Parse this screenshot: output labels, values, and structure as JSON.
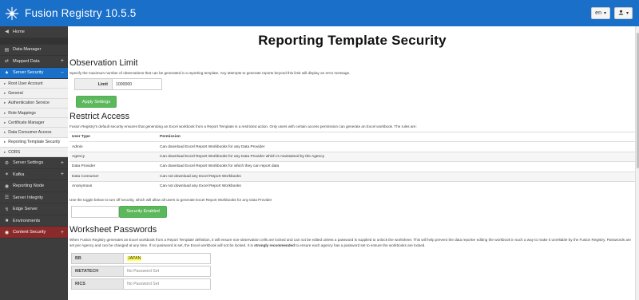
{
  "app": {
    "title": "Fusion Registry 10.5.5"
  },
  "topbar": {
    "language": "en",
    "user_caret": "▾",
    "lang_caret": "▾"
  },
  "sidebar": {
    "items": [
      {
        "label": "Home",
        "icon": "back-arrow-icon"
      },
      {
        "label": "Data Manager",
        "icon": "document-icon"
      },
      {
        "label": "Mapped Data",
        "icon": "shuffle-icon"
      },
      {
        "label": "Server Security",
        "icon": "shield-icon"
      }
    ],
    "sub_items": [
      "Root User Account",
      "General",
      "Authentication Service",
      "Role Mappings",
      "Certificate Manager",
      "Data Consumer Access",
      "Reporting Template Security",
      "CORS"
    ],
    "items_after": [
      {
        "label": "Server Settings",
        "icon": "gear-icon"
      },
      {
        "label": "Kafka",
        "icon": "kafka-icon"
      },
      {
        "label": "Reporting Node",
        "icon": "node-icon"
      },
      {
        "label": "Server Integrity",
        "icon": "integrity-icon"
      },
      {
        "label": "Edge Server",
        "icon": "edge-server-icon"
      },
      {
        "label": "Environments",
        "icon": "environments-icon"
      },
      {
        "label": "Content Security",
        "icon": "lock-icon"
      }
    ],
    "colors": {
      "background": "#3d3d3d",
      "active": "#1a6fc9",
      "danger": "#8a2a2a"
    }
  },
  "main": {
    "title": "Reporting Template Security",
    "observation_limit": {
      "heading": "Observation Limit",
      "description": "Specify the maximum number of observations that can be generated in a reporting template. Any attempts to generate reports beyond this limit will display an error message.",
      "label": "Limit",
      "value": "1000000",
      "apply_label": "Apply Settings"
    },
    "restrict_access": {
      "heading": "Restrict Access",
      "description": "Fusion Registry's default security ensures that generating an Excel workbook from a Report Template is a restricted action. Only users with certain access permission can generate an Excel workbook. The rules are:",
      "columns": [
        "User Type",
        "Permission"
      ],
      "rows": [
        [
          "Admin",
          "Can download Excel Report Workbooks for any Data Provider"
        ],
        [
          "Agency",
          "Can download Excel Report Workbooks for any Data Provider which is maintained by the Agency"
        ],
        [
          "Data Provider",
          "Can download Excel Report Workbooks for which they can report data"
        ],
        [
          "Data Consumer",
          "Can not download any Excel Report Workbooks"
        ],
        [
          "Anonymous",
          "Can not download any Excel Report Workbooks"
        ]
      ],
      "toggle_note": "Use the toggle below to turn off security, which will allow all users to generate Excel Report Workbooks for any Data Provider",
      "security_button": "Security Enabled"
    },
    "worksheet_passwords": {
      "heading": "Worksheet Passwords",
      "desc_part1": "When Fusion Registry generates an Excel workbook from a Report Template definition, it will ensure non-observation cells are locked and can not be edited unless a password is supplied to unlock the worksheet. This will help prevent the data reporter editing the workbook in such a way to make it unreliable by the Fusion Registry. Passwords are set per Agency and can be changed at any time. If no password is set, the Excel workbook will not be locked. It is",
      "desc_strong": "strongly recommended",
      "desc_part2": "to ensure each agency has a password set to ensure the workbooks are locked.",
      "rows": [
        {
          "agency": "BB",
          "password": "JAPAN",
          "is_set": true
        },
        {
          "agency": "METATECH",
          "password": "No Password Set",
          "is_set": false
        },
        {
          "agency": "RICS",
          "password": "No Password Set",
          "is_set": false
        }
      ]
    }
  },
  "colors": {
    "topbar": "#1a6fc9",
    "button_green": "#5cb85c",
    "highlight": "#ffff60"
  }
}
